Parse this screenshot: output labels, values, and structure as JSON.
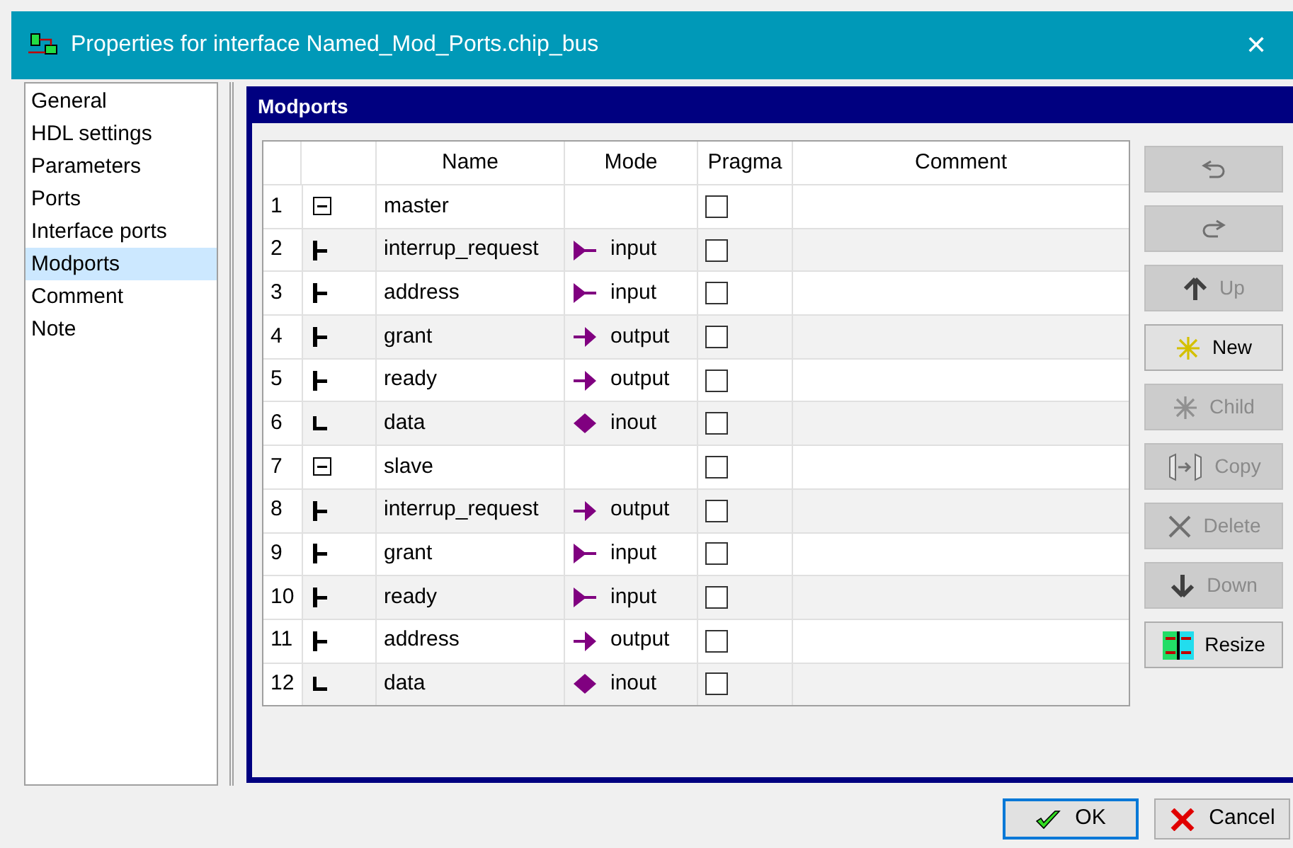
{
  "window": {
    "title": "Properties for interface Named_Mod_Ports.chip_bus",
    "close": "✕"
  },
  "sidebar": {
    "items": [
      {
        "label": "General",
        "selected": false
      },
      {
        "label": "HDL settings",
        "selected": false
      },
      {
        "label": "Parameters",
        "selected": false
      },
      {
        "label": "Ports",
        "selected": false
      },
      {
        "label": "Interface ports",
        "selected": false
      },
      {
        "label": "Modports",
        "selected": true
      },
      {
        "label": "Comment",
        "selected": false
      },
      {
        "label": "Note",
        "selected": false
      }
    ]
  },
  "panel": {
    "title": "Modports"
  },
  "table": {
    "columns": [
      "Name",
      "Mode",
      "Pragma",
      "Comment"
    ],
    "rows": [
      {
        "number": "1",
        "kind": "group",
        "name": "master",
        "pragma": false
      },
      {
        "number": "2",
        "kind": "tee",
        "name": "interrup_request",
        "mode": {
          "text": "input",
          "kind": "input"
        },
        "pragma": false
      },
      {
        "number": "3",
        "kind": "tee",
        "name": "address",
        "mode": {
          "text": "input",
          "kind": "input"
        },
        "pragma": false
      },
      {
        "number": "4",
        "kind": "tee",
        "name": "grant",
        "mode": {
          "text": "output",
          "kind": "output"
        },
        "pragma": false
      },
      {
        "number": "5",
        "kind": "tee",
        "name": "ready",
        "mode": {
          "text": "output",
          "kind": "output"
        },
        "pragma": false
      },
      {
        "number": "6",
        "kind": "end",
        "name": "data",
        "mode": {
          "text": "inout",
          "kind": "inout"
        },
        "pragma": false
      },
      {
        "number": "7",
        "kind": "group",
        "name": "slave",
        "pragma": false
      },
      {
        "number": "8",
        "kind": "tee",
        "name": "interrup_request",
        "mode": {
          "text": "output",
          "kind": "output"
        },
        "pragma": false
      },
      {
        "number": "9",
        "kind": "tee",
        "name": "grant",
        "mode": {
          "text": "input",
          "kind": "input"
        },
        "pragma": false
      },
      {
        "number": "10",
        "kind": "tee",
        "name": "ready",
        "mode": {
          "text": "input",
          "kind": "input"
        },
        "pragma": false
      },
      {
        "number": "11",
        "kind": "tee",
        "name": "address",
        "mode": {
          "text": "output",
          "kind": "output"
        },
        "pragma": false
      },
      {
        "number": "12",
        "kind": "end",
        "name": "data",
        "mode": {
          "text": "inout",
          "kind": "inout"
        },
        "pragma": false
      }
    ]
  },
  "side_buttons": [
    {
      "kind": "undo",
      "disabled": true
    },
    {
      "kind": "redo",
      "disabled": true
    },
    {
      "kind": "up",
      "label": "Up",
      "disabled": true
    },
    {
      "kind": "new",
      "label": "New",
      "disabled": false
    },
    {
      "kind": "child",
      "label": "Child",
      "disabled": true
    },
    {
      "kind": "copy",
      "label": "Copy",
      "disabled": true
    },
    {
      "kind": "delete",
      "label": "Delete",
      "disabled": true
    },
    {
      "kind": "down",
      "label": "Down",
      "disabled": true
    },
    {
      "kind": "resize",
      "label": "Resize",
      "disabled": false
    }
  ],
  "footer": {
    "buttons": [
      {
        "kind": "ok",
        "label": "OK",
        "focused": true
      },
      {
        "kind": "cancel",
        "label": "Cancel",
        "focused": false
      }
    ]
  }
}
